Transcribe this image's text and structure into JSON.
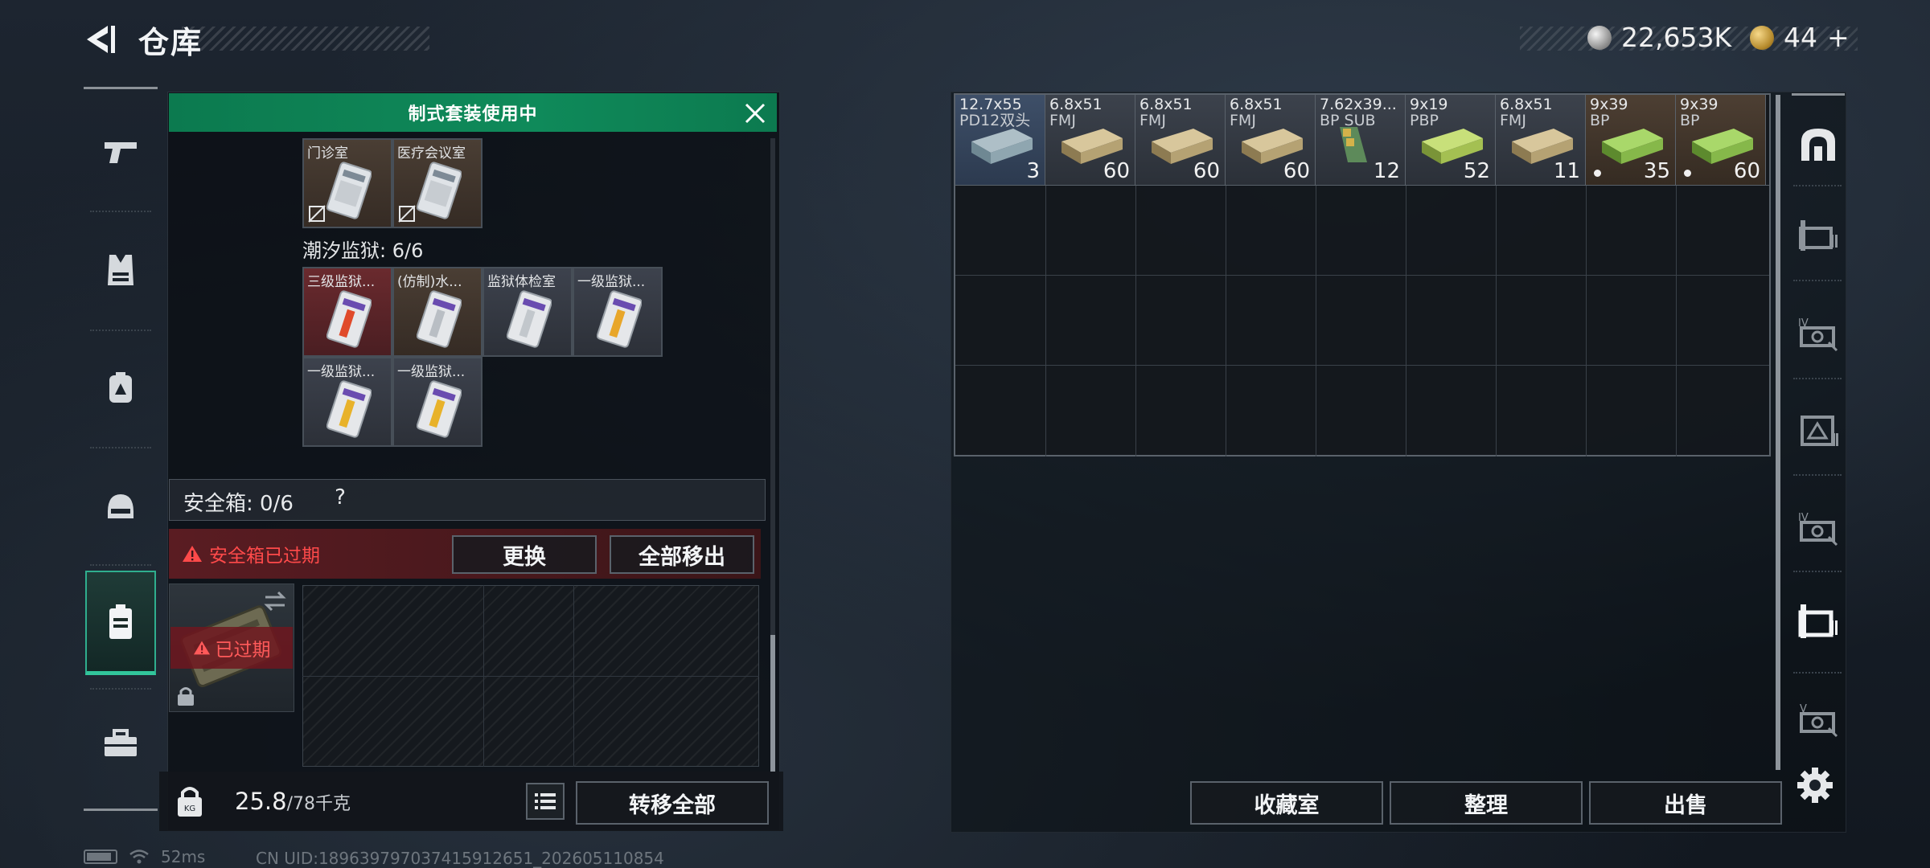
{
  "header": {
    "title": "仓库",
    "silver_amount": "22,653K",
    "gold_amount": "44",
    "gold_plus": "+"
  },
  "loadout_banner": "制式套装使用中",
  "top_items": [
    {
      "label": "门诊室",
      "bg": "brown"
    },
    {
      "label": "医疗会议室",
      "bg": "brown"
    }
  ],
  "section": {
    "title": "潮汐监狱: 6/6"
  },
  "prison_items": [
    {
      "label": "三级监狱...",
      "bg": "red"
    },
    {
      "label": "(仿制)水...",
      "bg": "brown"
    },
    {
      "label": "监狱体检室",
      "bg": "gray"
    },
    {
      "label": "一级监狱...",
      "bg": "gray"
    },
    {
      "label": "一级监狱...",
      "bg": "gray"
    },
    {
      "label": "一级监狱...",
      "bg": "gray"
    }
  ],
  "safe_box": {
    "label": "安全箱: 0/6",
    "help": "?",
    "expired_warning": "安全箱已过期",
    "replace_btn": "更换",
    "move_all_btn": "全部移出",
    "expired_tag": "已过期"
  },
  "bottom_left": {
    "weight_value": "25.8",
    "weight_max": "/78千克",
    "transfer_all_btn": "转移全部"
  },
  "storage_items": [
    {
      "line1": "12.7x55",
      "line2": "PD12双头",
      "count": "3",
      "bg": "blue",
      "dot": false
    },
    {
      "line1": "6.8x51",
      "line2": "FMJ",
      "count": "60",
      "bg": "gray",
      "dot": false
    },
    {
      "line1": "6.8x51",
      "line2": "FMJ",
      "count": "60",
      "bg": "gray",
      "dot": false
    },
    {
      "line1": "6.8x51",
      "line2": "FMJ",
      "count": "60",
      "bg": "gray",
      "dot": false
    },
    {
      "line1": "7.62x39...",
      "line2": "BP SUB",
      "count": "12",
      "bg": "gray",
      "dot": false
    },
    {
      "line1": "9x19",
      "line2": "PBP",
      "count": "52",
      "bg": "gray",
      "dot": false
    },
    {
      "line1": "6.8x51",
      "line2": "FMJ",
      "count": "11",
      "bg": "gray",
      "dot": false
    },
    {
      "line1": "9x39",
      "line2": "BP",
      "count": "35",
      "bg": "brown",
      "dot": true
    },
    {
      "line1": "9x39",
      "line2": "BP",
      "count": "60",
      "bg": "brown",
      "dot": true
    }
  ],
  "storage_buttons": {
    "collection": "收藏室",
    "sort": "整理",
    "sell": "出售"
  },
  "status_bar": {
    "ping": "52ms",
    "uid": "CN UID:18963979703741591265​1_202605110854"
  },
  "colors": {
    "accent_green": "#0f8a5a",
    "warning_red": "#ff4a4a",
    "active_nav": "#32c59b"
  },
  "left_nav_icons": [
    "pistol-icon",
    "vest-icon",
    "backpack-icon",
    "helmet-icon",
    "safe-case-icon",
    "toolbox-icon"
  ],
  "right_nav_icons": [
    "arch-icon",
    "storage-shelf-icon",
    "storage-iv-icon",
    "storage-triangle-icon",
    "storage-iv-2-icon",
    "storage-shelf-active-icon",
    "storage-v-icon"
  ]
}
